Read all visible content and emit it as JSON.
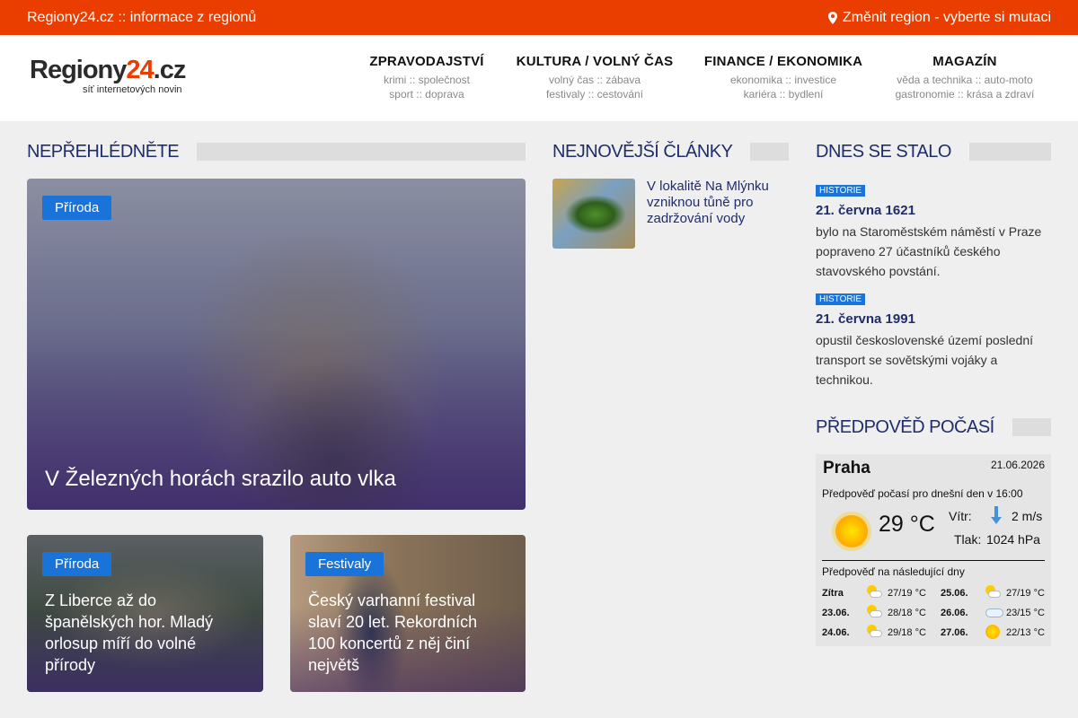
{
  "topbar": {
    "site": "Regiony24.cz :: informace z regionů",
    "region": "Změnit region - vyberte si mutaci",
    "icon": "map-pin-icon"
  },
  "logo": {
    "word_a": "Regiony",
    "word_b": "24",
    "word_c": ".cz",
    "tagline": "síť internetových novin"
  },
  "nav": [
    {
      "label": "ZPRAVODAJSTVÍ",
      "sub1": "krimi :: společnost",
      "sub2": "sport :: doprava"
    },
    {
      "label": "KULTURA / VOLNÝ ČAS",
      "sub1": "volný čas :: zábava",
      "sub2": "festivaly :: cestování"
    },
    {
      "label": "FINANCE / EKONOMIKA",
      "sub1": "ekonomika :: investice",
      "sub2": "kariéra :: bydlení"
    },
    {
      "label": "MAGAZÍN",
      "sub1": "věda a technika :: auto-moto",
      "sub2": "gastronomie :: krása a zdraví"
    }
  ],
  "sections": {
    "dontmiss": "NEPŘEHLÉDNĚTE",
    "newest": "NEJNOVĚJŠÍ ČLÁNKY",
    "today": "DNES SE STALO",
    "weather": "PŘEDPOVĚĎ POČASÍ"
  },
  "featured": {
    "main": {
      "badge": "Příroda",
      "title": "V Železných horách srazilo auto vlka"
    },
    "left": {
      "badge": "Příroda",
      "title": "Z Liberce až do španělských hor. Mladý orlosup míří do volné přírody"
    },
    "right": {
      "badge": "Festivaly",
      "title": "Český varhanní festival slaví 20 let. Rekordních 100 koncertů z něj činí největš"
    }
  },
  "newest": [
    {
      "title": "V lokalitě Na Mlýnku vzniknou tůně pro zadržování vody"
    }
  ],
  "history": [
    {
      "tag": "HISTORIE",
      "date": "21. června 1621",
      "text": "bylo na Staroměstském náměstí v Praze popraveno 27 účastníků českého stavovského povstání."
    },
    {
      "tag": "HISTORIE",
      "date": "21. června 1991",
      "text": "opustil československé území poslední transport se sovětskými vojáky a technikou."
    }
  ],
  "weather": {
    "city": "Praha",
    "date": "21.06.2026",
    "today_label": "Předpověď počasí pro dnešní den v 16:00",
    "temp": "29 °C",
    "wind_label": "Vítr:",
    "wind": "2 m/s",
    "pressure_label": "Tlak:",
    "pressure": "1024 hPa",
    "next_label": "Předpověď na následující dny",
    "forecast": [
      {
        "day": "Zítra",
        "temp": "27/19 °C",
        "icon": "partly-cloudy-icon"
      },
      {
        "day": "25.06.",
        "temp": "27/19 °C",
        "icon": "partly-cloudy-icon"
      },
      {
        "day": "23.06.",
        "temp": "28/18 °C",
        "icon": "partly-cloudy-icon"
      },
      {
        "day": "26.06.",
        "temp": "23/15 °C",
        "icon": "cloud-icon"
      },
      {
        "day": "24.06.",
        "temp": "29/18 °C",
        "icon": "partly-cloudy-icon"
      },
      {
        "day": "27.06.",
        "temp": "22/13 °C",
        "icon": "sun-icon"
      }
    ]
  },
  "colors": {
    "accent": "#ea3d00",
    "badge": "#1a73d9",
    "heading": "#1f2d6b"
  }
}
